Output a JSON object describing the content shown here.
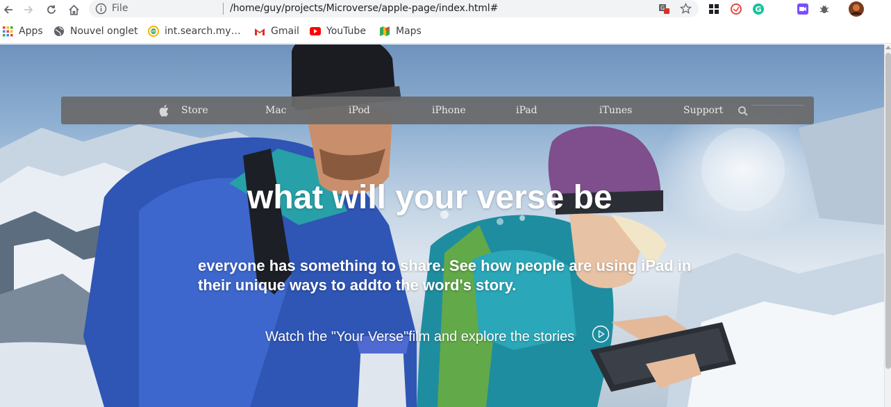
{
  "browser": {
    "scheme_label": "File",
    "url": "/home/guy/projects/Microverse/apple-page/index.html#",
    "icons": [
      "back-arrow-icon",
      "forward-arrow-icon",
      "reload-icon",
      "home-icon",
      "info-icon",
      "translate-icon",
      "star-icon",
      "extension-icon",
      "avatar"
    ]
  },
  "bookmarks": [
    {
      "label": "Apps",
      "icon": "apps-grid-icon"
    },
    {
      "label": "Nouvel onglet",
      "icon": "globe-icon"
    },
    {
      "label": "int.search.my…",
      "icon": "mywebsearch-icon"
    },
    {
      "label": "Gmail",
      "icon": "gmail-icon"
    },
    {
      "label": "YouTube",
      "icon": "youtube-icon"
    },
    {
      "label": "Maps",
      "icon": "maps-icon"
    }
  ],
  "nav": {
    "items": [
      "Store",
      "Mac",
      "iPod",
      "iPhone",
      "iPad",
      "iTunes",
      "Support"
    ],
    "search_placeholder": ""
  },
  "hero": {
    "title": "what will your verse be",
    "subtitle": "everyone has something to share. See how people are using iPad in their unique ways to addto the word's story.",
    "watch_text": "Watch the \"Your Verse\"film and explore the stories"
  },
  "colors": {
    "nav_bg": "#696969",
    "hero_text": "#ffffff",
    "sky": "#8fb0d2"
  }
}
